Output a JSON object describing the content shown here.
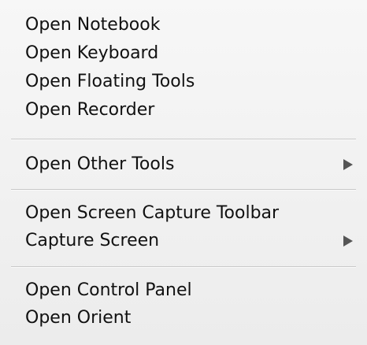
{
  "menu": {
    "groups": [
      {
        "items": [
          {
            "label": "Open Notebook"
          },
          {
            "label": "Open Keyboard"
          },
          {
            "label": "Open Floating Tools"
          },
          {
            "label": "Open Recorder"
          }
        ]
      },
      {
        "items": [
          {
            "label": "Open Other Tools",
            "submenu_icon": "submenu-arrow-icon"
          }
        ]
      },
      {
        "items": [
          {
            "label": "Open Screen Capture Toolbar"
          },
          {
            "label": "Capture Screen",
            "submenu_icon": "submenu-arrow-icon"
          }
        ]
      },
      {
        "items": [
          {
            "label": "Open Control Panel"
          },
          {
            "label": "Open Orient"
          }
        ]
      }
    ]
  }
}
